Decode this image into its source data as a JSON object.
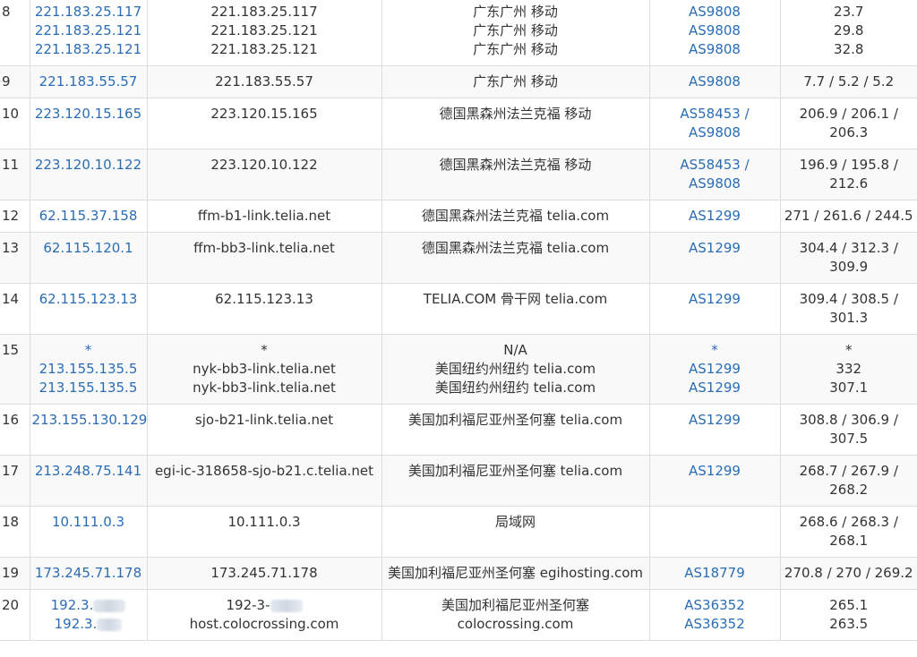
{
  "rows": [
    {
      "hop": "8",
      "ip": [
        "221.183.25.117",
        "221.183.25.121",
        "221.183.25.121"
      ],
      "host": [
        "221.183.25.117",
        "221.183.25.121",
        "221.183.25.121"
      ],
      "loc": [
        "广东广州 移动",
        "广东广州 移动",
        "广东广州 移动"
      ],
      "asn": [
        "AS9808",
        "AS9808",
        "AS9808"
      ],
      "lat": [
        "23.7",
        "29.8",
        "32.8"
      ]
    },
    {
      "hop": "9",
      "ip": [
        "221.183.55.57"
      ],
      "host": [
        "221.183.55.57"
      ],
      "loc": [
        "广东广州 移动"
      ],
      "asn": [
        "AS9808"
      ],
      "lat": [
        "7.7 / 5.2 / 5.2"
      ]
    },
    {
      "hop": "10",
      "ip": [
        "223.120.15.165"
      ],
      "host": [
        "223.120.15.165"
      ],
      "loc": [
        "德国黑森州法兰克福 移动"
      ],
      "asn": [
        "AS58453 /",
        "AS9808"
      ],
      "lat": [
        "206.9 / 206.1 /",
        "206.3"
      ]
    },
    {
      "hop": "11",
      "ip": [
        "223.120.10.122"
      ],
      "host": [
        "223.120.10.122"
      ],
      "loc": [
        "德国黑森州法兰克福 移动"
      ],
      "asn": [
        "AS58453 /",
        "AS9808"
      ],
      "lat": [
        "196.9 / 195.8 /",
        "212.6"
      ]
    },
    {
      "hop": "12",
      "ip": [
        "62.115.37.158"
      ],
      "host": [
        "ffm-b1-link.telia.net"
      ],
      "loc": [
        "德国黑森州法兰克福 telia.com"
      ],
      "asn": [
        "AS1299"
      ],
      "lat": [
        "271 / 261.6 / 244.5"
      ]
    },
    {
      "hop": "13",
      "ip": [
        "62.115.120.1"
      ],
      "host": [
        "ffm-bb3-link.telia.net"
      ],
      "loc": [
        "德国黑森州法兰克福 telia.com"
      ],
      "asn": [
        "AS1299"
      ],
      "lat": [
        "304.4 / 312.3 /",
        "309.9"
      ]
    },
    {
      "hop": "14",
      "ip": [
        "62.115.123.13"
      ],
      "host": [
        "62.115.123.13"
      ],
      "loc": [
        "TELIA.COM 骨干网 telia.com"
      ],
      "asn": [
        "AS1299"
      ],
      "lat": [
        "309.4 / 308.5 /",
        "301.3"
      ]
    },
    {
      "hop": "15",
      "ip": [
        "*",
        "213.155.135.5",
        "213.155.135.5"
      ],
      "host": [
        "*",
        "nyk-bb3-link.telia.net",
        "nyk-bb3-link.telia.net"
      ],
      "loc": [
        "N/A",
        "美国纽约州纽约 telia.com",
        "美国纽约州纽约 telia.com"
      ],
      "asn": [
        "*",
        "AS1299",
        "AS1299"
      ],
      "lat": [
        "*",
        "332",
        "307.1"
      ]
    },
    {
      "hop": "16",
      "ip": [
        "213.155.130.129"
      ],
      "host": [
        "sjo-b21-link.telia.net"
      ],
      "loc": [
        "美国加利福尼亚州圣何塞 telia.com"
      ],
      "asn": [
        "AS1299"
      ],
      "lat": [
        "308.8 / 306.9 /",
        "307.5"
      ]
    },
    {
      "hop": "17",
      "ip": [
        "213.248.75.141"
      ],
      "host": [
        "egi-ic-318658-sjo-b21.c.telia.net"
      ],
      "loc": [
        "美国加利福尼亚州圣何塞 telia.com"
      ],
      "asn": [
        "AS1299"
      ],
      "lat": [
        "268.7 / 267.9 /",
        "268.2"
      ]
    },
    {
      "hop": "18",
      "ip": [
        "10.111.0.3"
      ],
      "host": [
        "10.111.0.3"
      ],
      "loc": [
        "局域网"
      ],
      "asn": [],
      "lat": [
        "268.6 / 268.3 /",
        "268.1"
      ]
    },
    {
      "hop": "19",
      "ip": [
        "173.245.71.178"
      ],
      "host": [
        "173.245.71.178"
      ],
      "loc": [
        "美国加利福尼亚州圣何塞 egihosting.com"
      ],
      "asn": [
        "AS18779"
      ],
      "lat": [
        "270.8 / 270 / 269.2"
      ]
    },
    {
      "hop": "20",
      "ip": [
        "192.3.",
        "192.3."
      ],
      "host": [
        "192-3-",
        "host.colocrossing.com"
      ],
      "loc": [
        "美国加利福尼亚州圣何塞",
        "colocrossing.com"
      ],
      "asn": [
        "AS36352",
        "AS36352"
      ],
      "lat": [
        "265.1",
        "263.5"
      ]
    }
  ]
}
